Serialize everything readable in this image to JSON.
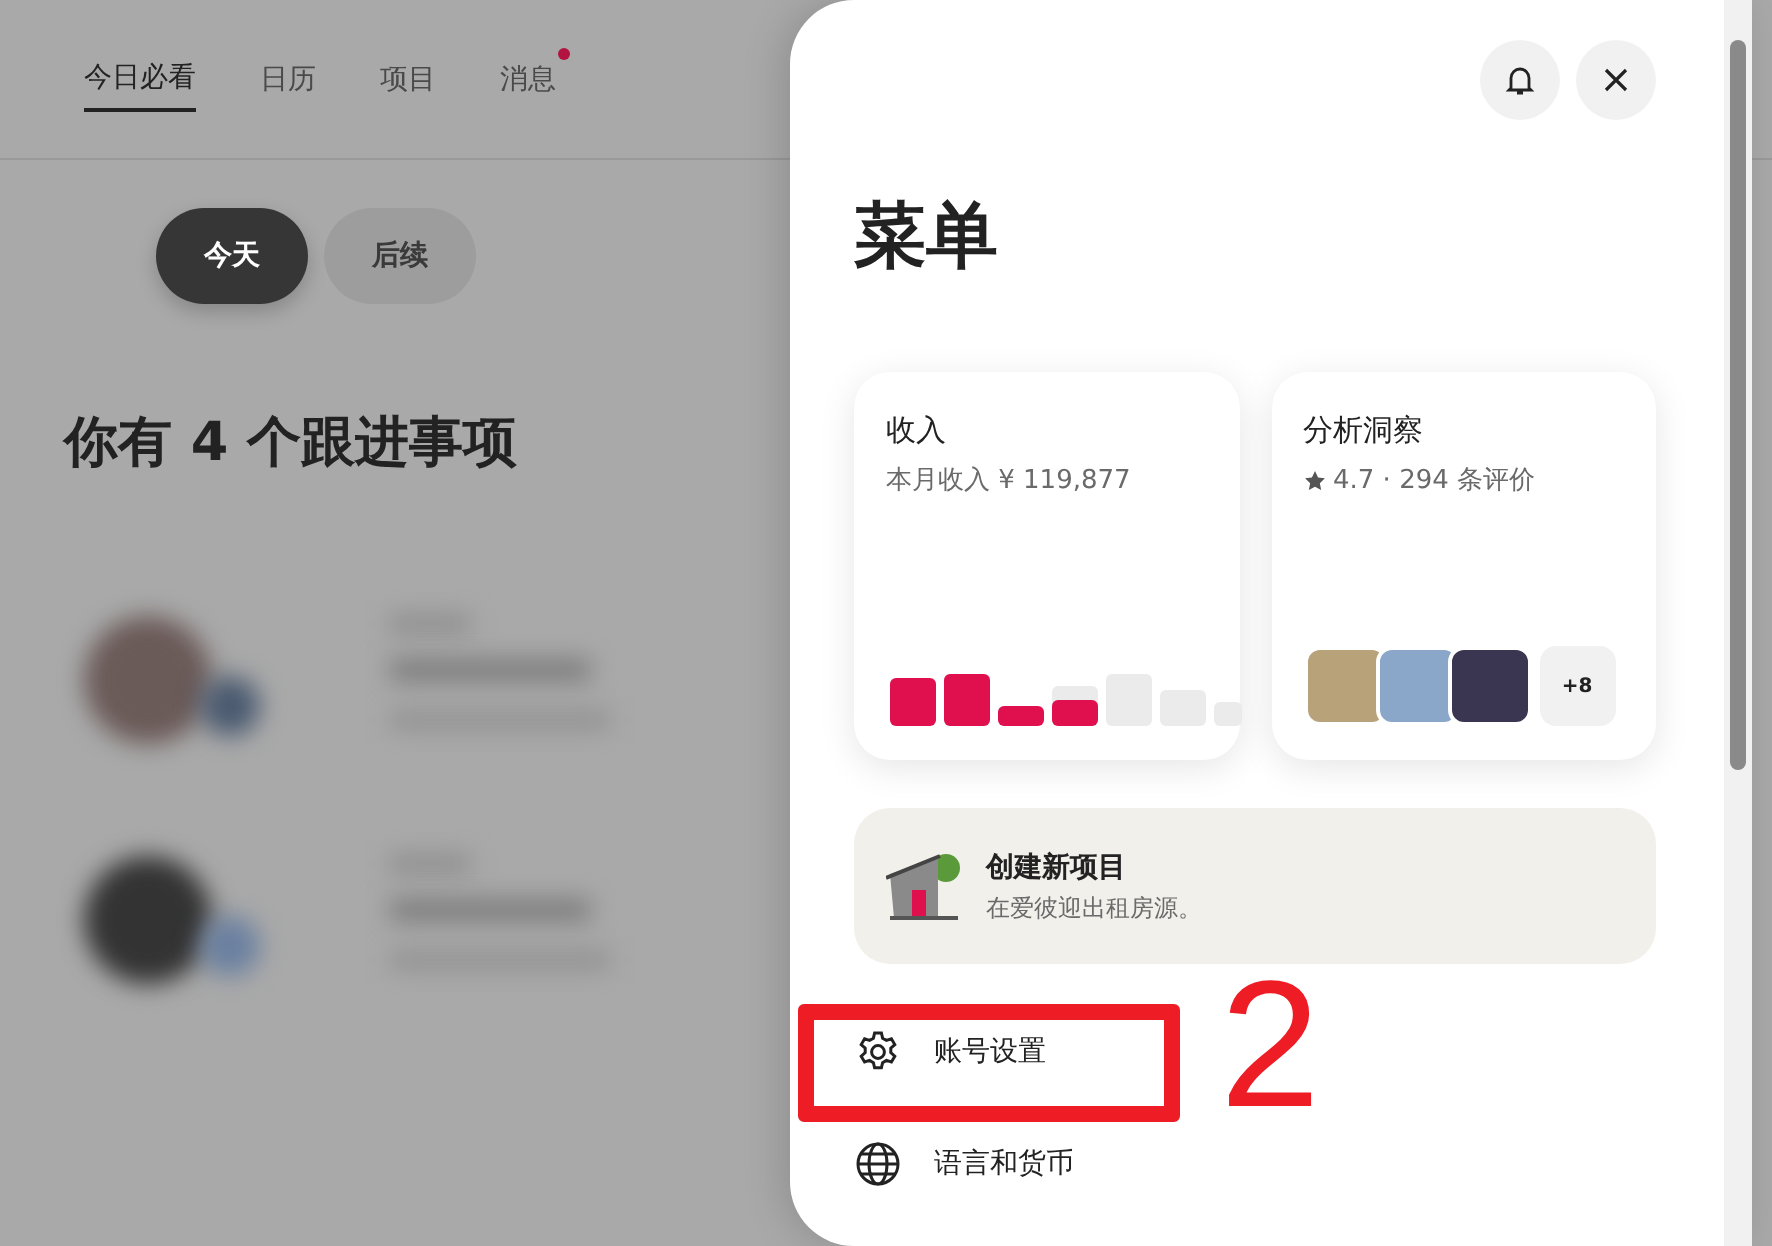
{
  "background": {
    "tabs": [
      {
        "label": "今日必看",
        "selected": true,
        "dot": false
      },
      {
        "label": "日历",
        "selected": false,
        "dot": false
      },
      {
        "label": "项目",
        "selected": false,
        "dot": false
      },
      {
        "label": "消息",
        "selected": false,
        "dot": true
      }
    ],
    "filters": [
      {
        "label": "今天",
        "selected": true
      },
      {
        "label": "后续",
        "selected": false
      }
    ],
    "heading": "你有 4 个跟进事项"
  },
  "menu": {
    "title": "菜单",
    "cards": [
      {
        "kind": "revenue",
        "title": "收入",
        "subtitle": "本月收入 ¥ 119,877"
      },
      {
        "kind": "insights",
        "title": "分析洞察",
        "rating": "4.7 · 294 条评价",
        "more": "+8"
      }
    ],
    "promo": {
      "title": "创建新项目",
      "subtitle": "在爱彼迎出租房源。"
    },
    "items": [
      {
        "kind": "gear",
        "label": "账号设置"
      },
      {
        "kind": "globe",
        "label": "语言和货币"
      }
    ]
  },
  "annotation": {
    "label": "2"
  }
}
